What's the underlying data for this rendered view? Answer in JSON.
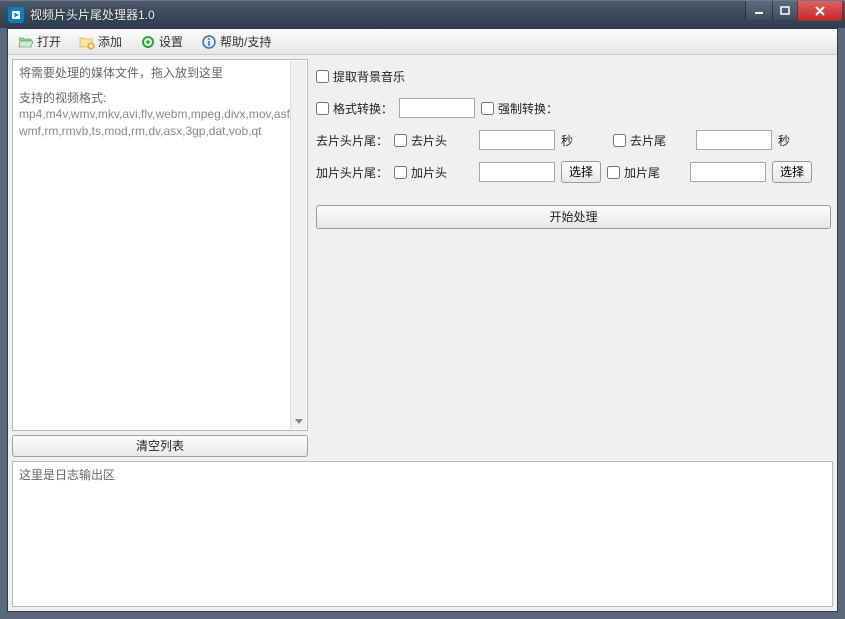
{
  "title": "视频片头片尾处理器1.0",
  "toolbar": {
    "open": "打开",
    "add": "添加",
    "settings": "设置",
    "help": "帮助/支持"
  },
  "left": {
    "hint": "将需要处理的媒体文件，拖入放到这里",
    "formats_title": "支持的视频格式:",
    "formats_list": "mp4,m4v,wmv,mkv,avi,flv,webm,mpeg,divx,mov,asf,wmf,rm,rmvb,ts,mod,rm,dv,asx,3gp,dat,vob,qt",
    "clear": "清空列表"
  },
  "options": {
    "extract_bgm": "提取背景音乐",
    "format_convert": "格式转换：",
    "format_value": "",
    "force_convert": "强制转换：",
    "trim_label": "去片头片尾：",
    "trim_head": "去片头",
    "trim_head_value": "",
    "seconds": "秒",
    "trim_tail": "去片尾",
    "trim_tail_value": "",
    "add_label": "加片头片尾：",
    "add_head": "加片头",
    "add_head_value": "",
    "select": "选择",
    "add_tail": "加片尾",
    "add_tail_value": "",
    "process": "开始处理"
  },
  "log": {
    "placeholder": "这里是日志输出区"
  }
}
